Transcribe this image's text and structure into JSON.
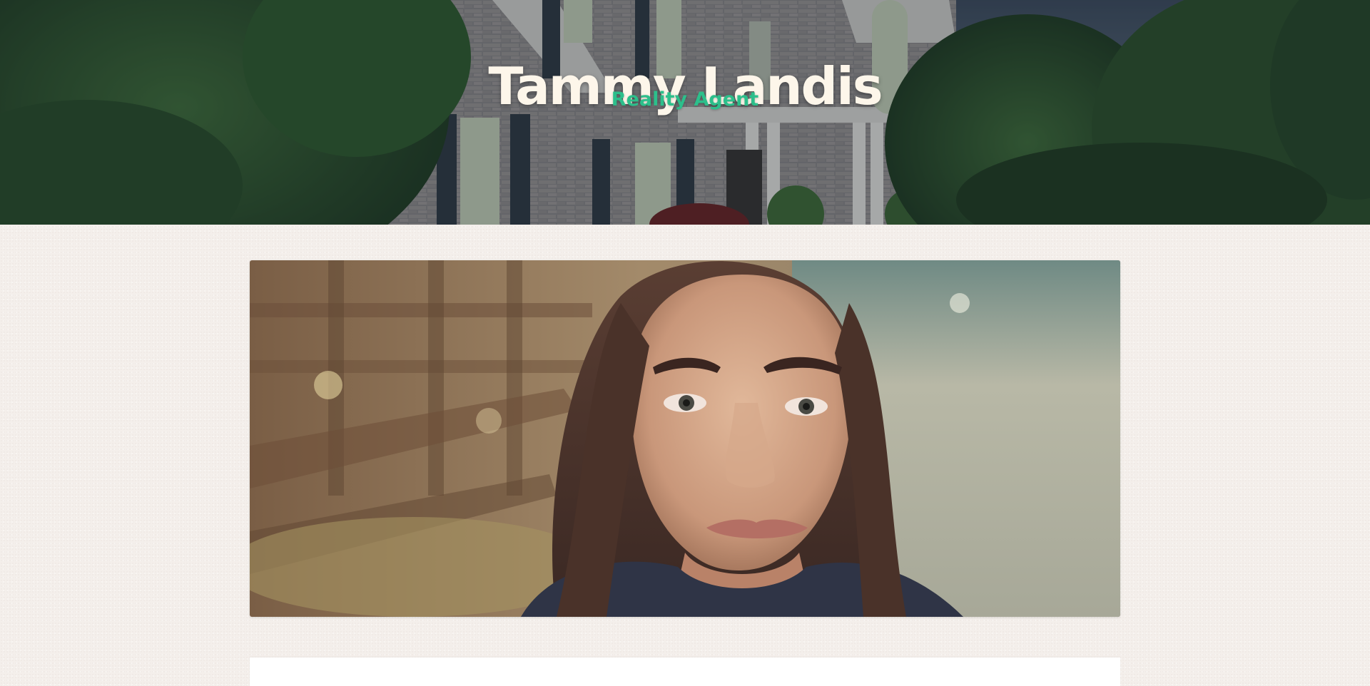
{
  "header": {
    "title": "Tammy Landis",
    "subtitle": "Reality Agent",
    "background_image": "house-exterior-photo"
  },
  "profile": {
    "photo": "agent-portrait-photo"
  },
  "colors": {
    "page_background": "#f4efeb",
    "title_color": "#fdf6ea",
    "subtitle_accent": "#2cbf8b",
    "card_background": "#ffffff"
  }
}
